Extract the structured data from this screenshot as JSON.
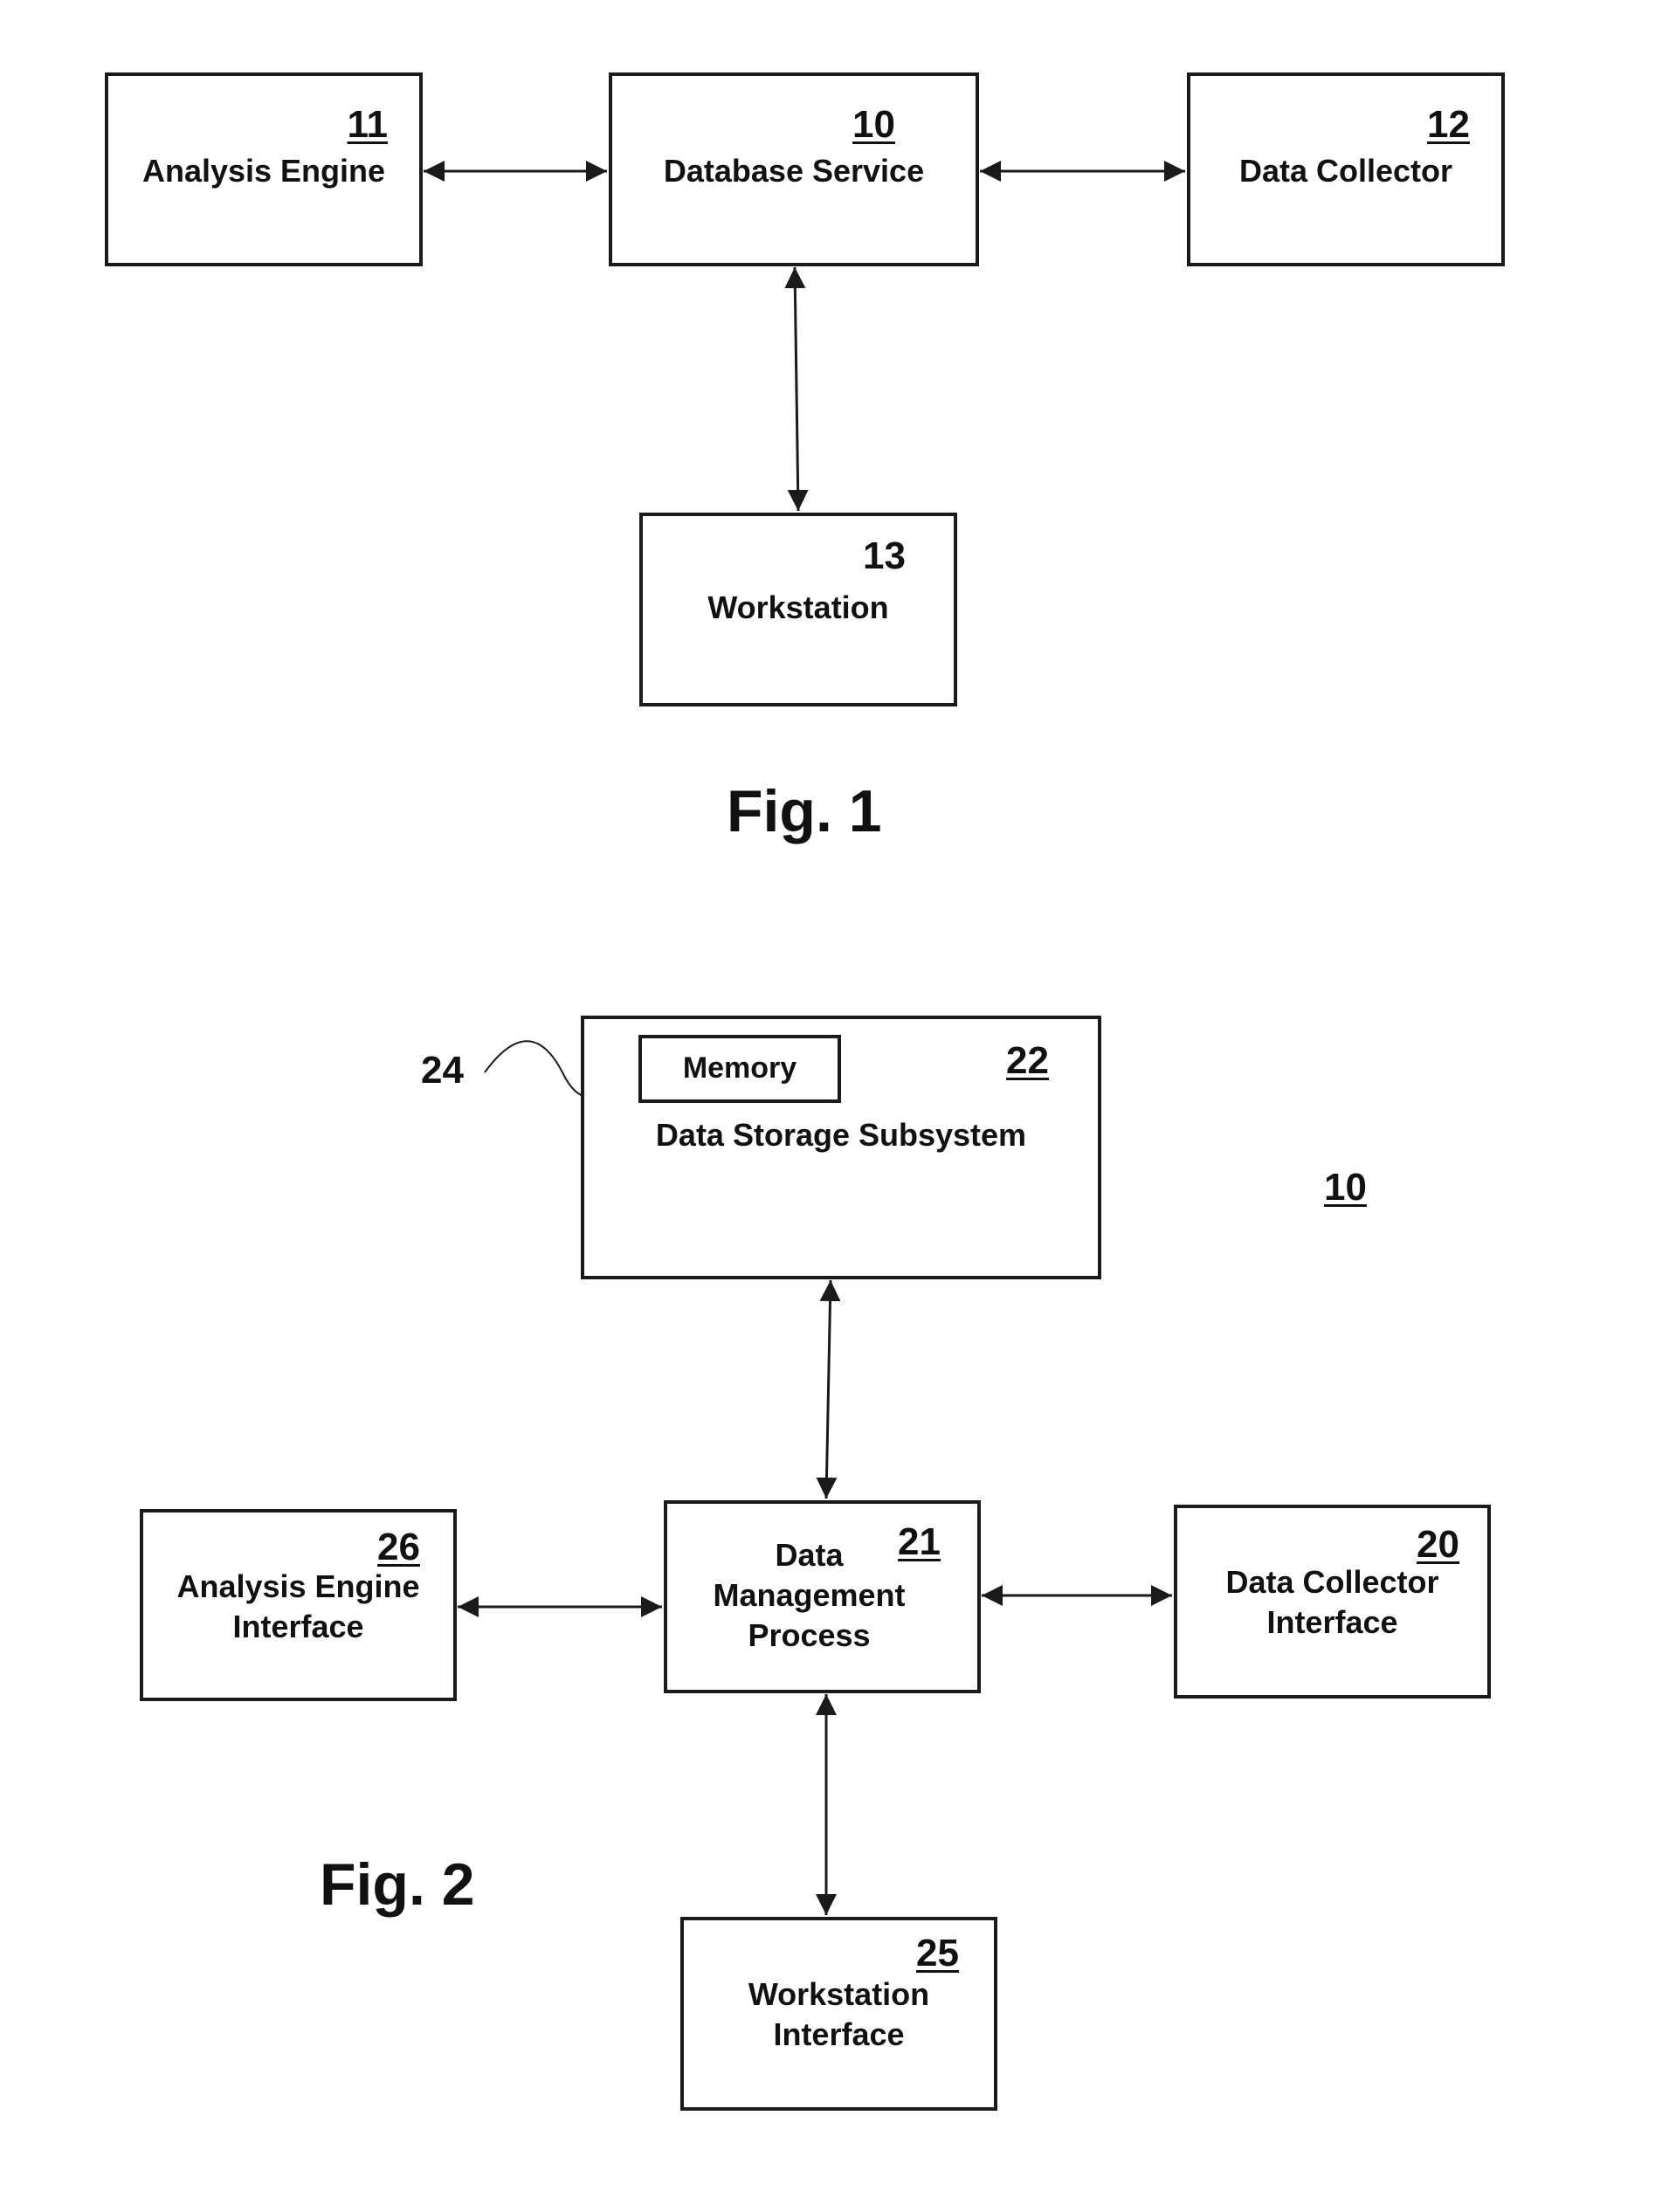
{
  "fig1": {
    "caption": "Fig. 1",
    "nodes": {
      "analysis_engine": {
        "ref": "11",
        "label": "Analysis Engine"
      },
      "database_service": {
        "ref": "10",
        "label": "Database Service"
      },
      "data_collector": {
        "ref": "12",
        "label": "Data Collector"
      },
      "workstation": {
        "ref": "13",
        "label": "Workstation"
      }
    },
    "edges": [
      {
        "from": "analysis_engine",
        "to": "database_service",
        "type": "bidirectional"
      },
      {
        "from": "database_service",
        "to": "data_collector",
        "type": "bidirectional"
      },
      {
        "from": "database_service",
        "to": "workstation",
        "type": "bidirectional"
      }
    ]
  },
  "fig2": {
    "caption": "Fig. 2",
    "system_ref": "10",
    "nodes": {
      "data_storage_subsystem": {
        "ref": "22",
        "label": "Data Storage Subsystem"
      },
      "memory": {
        "ref": "24",
        "label": "Memory"
      },
      "data_management_process": {
        "ref": "21",
        "label": "Data\nManagement\nProcess"
      },
      "analysis_engine_interface": {
        "ref": "26",
        "label": "Analysis Engine\nInterface"
      },
      "data_collector_interface": {
        "ref": "20",
        "label": "Data Collector\nInterface"
      },
      "workstation_interface": {
        "ref": "25",
        "label": "Workstation\nInterface"
      }
    },
    "edges": [
      {
        "from": "data_storage_subsystem",
        "to": "data_management_process",
        "type": "bidirectional"
      },
      {
        "from": "analysis_engine_interface",
        "to": "data_management_process",
        "type": "bidirectional"
      },
      {
        "from": "data_management_process",
        "to": "data_collector_interface",
        "type": "bidirectional"
      },
      {
        "from": "data_management_process",
        "to": "workstation_interface",
        "type": "bidirectional"
      }
    ]
  }
}
